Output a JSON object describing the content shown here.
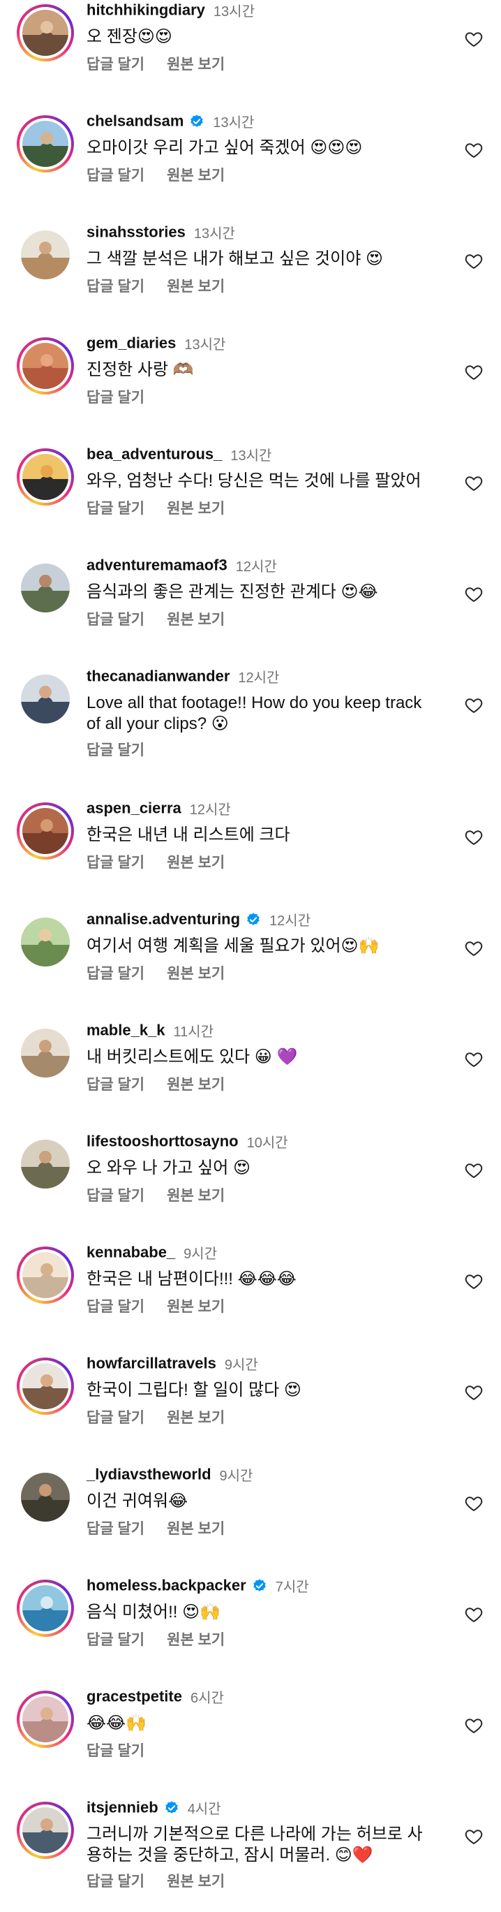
{
  "labels": {
    "reply": "답글 달기",
    "view_original": "원본 보기"
  },
  "comments": [
    {
      "username": "hitchhikingdiary",
      "verified": false,
      "time": "13시간",
      "text": "오 젠장😍😍",
      "show_original": true,
      "ring": true,
      "avatar_colors": [
        "#c9a17d",
        "#6b4d3a",
        "#e6c3a0"
      ]
    },
    {
      "username": "chelsandsam",
      "verified": true,
      "time": "13시간",
      "text": "오마이갓 우리 가고 싶어 죽겠어 😍😍😍",
      "show_original": true,
      "ring": true,
      "avatar_colors": [
        "#9cc6e3",
        "#3d5a3a",
        "#d7b28e"
      ]
    },
    {
      "username": "sinahsstories",
      "verified": false,
      "time": "13시간",
      "text": "그 색깔 분석은 내가 해보고 싶은 것이야 😍",
      "show_original": true,
      "ring": false,
      "avatar_colors": [
        "#e8e1d6",
        "#b58c62",
        "#cfa782"
      ]
    },
    {
      "username": "gem_diaries",
      "verified": false,
      "time": "13시간",
      "text": "진정한 사랑 🫶🏽",
      "show_original": false,
      "ring": true,
      "avatar_colors": [
        "#d78b61",
        "#b4593d",
        "#e8a57f"
      ]
    },
    {
      "username": "bea_adventurous_",
      "verified": false,
      "time": "13시간",
      "text": "와우, 엄청난 수다! 당신은 먹는 것에 나를 팔았어",
      "show_original": true,
      "ring": true,
      "avatar_colors": [
        "#f0c469",
        "#2b2b2b",
        "#e7a64a"
      ]
    },
    {
      "username": "adventuremamaof3",
      "verified": false,
      "time": "12시간",
      "text": "음식과의 좋은 관계는 진정한 관계다 😍😂",
      "show_original": true,
      "ring": false,
      "avatar_colors": [
        "#c7cfd8",
        "#5c6e4d",
        "#b7876a"
      ]
    },
    {
      "username": "thecanadianwander",
      "verified": false,
      "time": "12시간",
      "text": "Love all that footage!! How do you keep track of all your clips? 😮",
      "show_original": false,
      "ring": false,
      "avatar_colors": [
        "#d5dbe2",
        "#3b4a5e",
        "#d6a88a"
      ]
    },
    {
      "username": "aspen_cierra",
      "verified": false,
      "time": "12시간",
      "text": "한국은 내년 내 리스트에 크다",
      "show_original": true,
      "ring": true,
      "avatar_colors": [
        "#b36a4a",
        "#7a3f2b",
        "#d49a70"
      ]
    },
    {
      "username": "annalise.adventuring",
      "verified": true,
      "time": "12시간",
      "text": "여기서 여행 계획을 세울 필요가 있어😍🙌",
      "show_original": true,
      "ring": false,
      "avatar_colors": [
        "#bcd6a4",
        "#6a8c4e",
        "#e8cba4"
      ]
    },
    {
      "username": "mable_k_k",
      "verified": false,
      "time": "11시간",
      "text": "내 버킷리스트에도 있다 😀 💜",
      "show_original": true,
      "ring": false,
      "avatar_colors": [
        "#e6ddd0",
        "#a68a6c",
        "#caa17c"
      ]
    },
    {
      "username": "lifestooshorttosayno",
      "verified": false,
      "time": "10시간",
      "text": "오 와우 나 가고 싶어 😍",
      "show_original": true,
      "ring": false,
      "avatar_colors": [
        "#d8cfbf",
        "#6d6a52",
        "#c9a27e"
      ]
    },
    {
      "username": "kennababe_",
      "verified": false,
      "time": "9시간",
      "text": "한국은 내 남편이다!!! 😂😂😂",
      "show_original": true,
      "ring": true,
      "avatar_colors": [
        "#f1e4d2",
        "#c9b49a",
        "#d8b08a"
      ]
    },
    {
      "username": "howfarcillatravels",
      "verified": false,
      "time": "9시간",
      "text": "한국이 그립다! 할 일이 많다 😍",
      "show_original": true,
      "ring": true,
      "avatar_colors": [
        "#e9e5de",
        "#7a5a45",
        "#d9ab86"
      ]
    },
    {
      "username": "_lydiavstheworld",
      "verified": false,
      "time": "9시간",
      "text": "이건 귀여워😂",
      "show_original": true,
      "ring": false,
      "avatar_colors": [
        "#6f6a5c",
        "#3d3a30",
        "#c79a72"
      ]
    },
    {
      "username": "homeless.backpacker",
      "verified": true,
      "time": "7시간",
      "text": "음식 미쳤어!! 😍🙌",
      "show_original": true,
      "ring": true,
      "avatar_colors": [
        "#8fc7e0",
        "#2f7fb0",
        "#d9e9f2"
      ]
    },
    {
      "username": "gracestpetite",
      "verified": false,
      "time": "6시간",
      "text": "😂😂🙌",
      "show_original": false,
      "ring": true,
      "avatar_colors": [
        "#e4c6c9",
        "#b98e86",
        "#ddb28f"
      ]
    },
    {
      "username": "itsjennieb",
      "verified": true,
      "time": "4시간",
      "text": "그러니까 기본적으로 다른 나라에 가는 허브로 사용하는 것을 중단하고, 잠시 머물러. 😊❤️",
      "show_original": true,
      "ring": true,
      "avatar_colors": [
        "#d9d6cf",
        "#4a5d6e",
        "#d7a884"
      ]
    }
  ]
}
